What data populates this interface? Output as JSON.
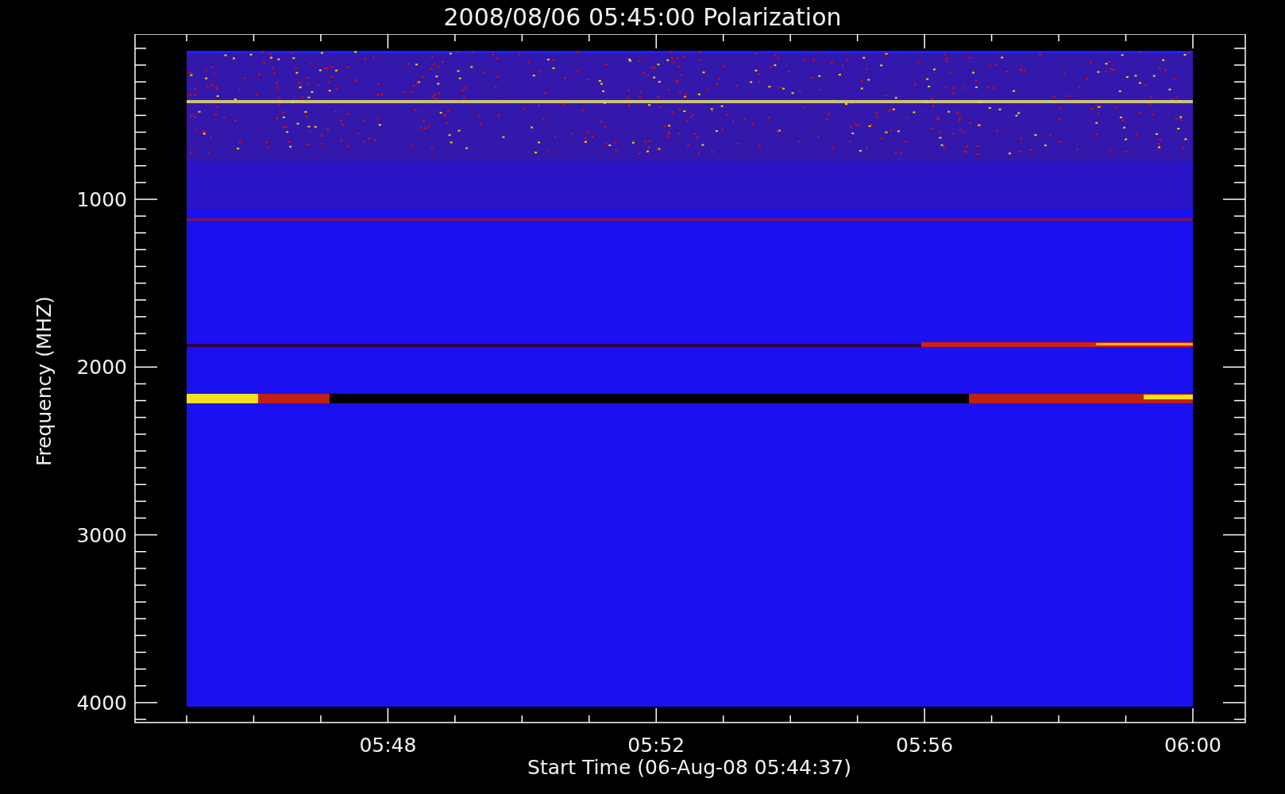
{
  "title": "2008/08/06 05:45:00 Polarization",
  "plot": {
    "xlabel": "Start Time (06-Aug-08 05:44:37)",
    "ylabel": "Frequency (MHZ)",
    "xtick_labels": [
      "05:48",
      "05:52",
      "05:56",
      "06:00"
    ],
    "ytick_labels": [
      "1000",
      "2000",
      "3000",
      "4000"
    ]
  }
}
